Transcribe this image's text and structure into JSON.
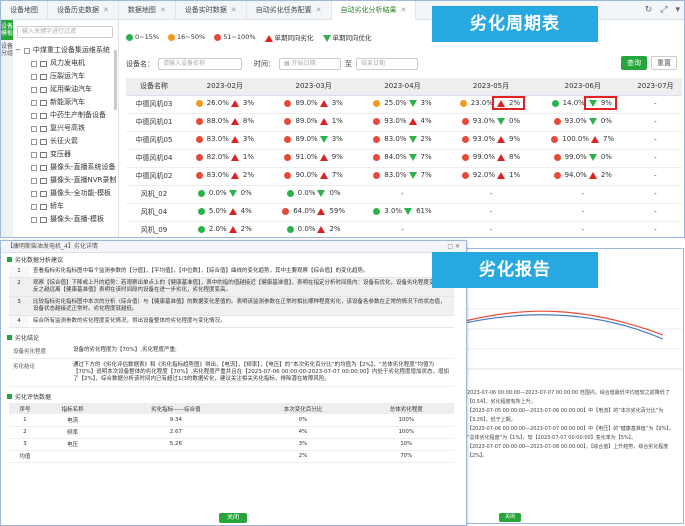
{
  "tabs": [
    {
      "label": "设备地图",
      "active": false
    },
    {
      "label": "设备历史数据",
      "active": false
    },
    {
      "label": "数据地图",
      "active": false
    },
    {
      "label": "设备实时数据",
      "active": false
    },
    {
      "label": "自动劣化任务配置",
      "active": false
    },
    {
      "label": "自动劣化分析结果",
      "active": true
    }
  ],
  "sidebar": {
    "vtabs": [
      "设备模板",
      "设备分组"
    ],
    "search_placeholder": "输入关键字进行过滤",
    "root": "中煤重工设备集运维系统",
    "items": [
      "风力发电机",
      "压裂运汽车",
      "延用柴油汽车",
      "新能源汽车",
      "中药生产制备设备",
      "复兴号高铁",
      "长征火箭",
      "变压器",
      "摄像头-直播系统设备",
      "摄像头-直播NVR录制",
      "摄像头-全功能-模板",
      "轿车",
      "摄像头-直播-模板"
    ]
  },
  "legend": {
    "items": [
      "0~15%",
      "16~50%",
      "51~100%",
      "单期同向劣化",
      "单期同向优化"
    ],
    "colors": [
      "#2bb24c",
      "#f39a1e",
      "#e74a3b"
    ]
  },
  "filter": {
    "device_label": "设备名：",
    "device_placeholder": "请输入设备名称",
    "time_label": "时间：",
    "start_placeholder": "开始日期",
    "sep": "至",
    "end_placeholder": "结束日期",
    "query": "查询",
    "reset": "重置"
  },
  "badges": {
    "top": "劣化周期表",
    "bottom": "劣化报告"
  },
  "table": {
    "headers": [
      "设备名称",
      "2023-02月",
      "2023-03月",
      "2023-04月",
      "2023-05月",
      "2023-06月",
      "2023-07月"
    ],
    "rows": [
      {
        "name": "中德风机03",
        "cells": [
          [
            "o",
            "26.0%",
            "up",
            "3%"
          ],
          [
            "r",
            "89.0%",
            "up",
            "3%"
          ],
          [
            "o",
            "25.0%",
            "dn",
            "3%"
          ],
          [
            "o",
            "23.0%",
            "up",
            "2%",
            true
          ],
          [
            "g",
            "14.0%",
            "dn",
            "9%",
            true
          ],
          [
            "",
            "-",
            "",
            ""
          ]
        ]
      },
      {
        "name": "中德风机01",
        "cells": [
          [
            "r",
            "88.0%",
            "up",
            "8%"
          ],
          [
            "r",
            "89.0%",
            "up",
            "1%"
          ],
          [
            "r",
            "93.0%",
            "up",
            "4%"
          ],
          [
            "r",
            "93.0%",
            "dn",
            "0%"
          ],
          [
            "r",
            "93.0%",
            "dn",
            "0%"
          ],
          [
            "",
            "-",
            "",
            ""
          ]
        ]
      },
      {
        "name": "中德风机05",
        "cells": [
          [
            "r",
            "83.0%",
            "up",
            "3%"
          ],
          [
            "r",
            "89.0%",
            "dn",
            "3%"
          ],
          [
            "r",
            "83.0%",
            "dn",
            "2%"
          ],
          [
            "r",
            "93.0%",
            "up",
            "9%"
          ],
          [
            "r",
            "100.0%",
            "up",
            "7%"
          ],
          [
            "",
            "-",
            "",
            ""
          ]
        ]
      },
      {
        "name": "中德风机04",
        "cells": [
          [
            "r",
            "82.0%",
            "up",
            "1%"
          ],
          [
            "r",
            "91.0%",
            "up",
            "9%"
          ],
          [
            "r",
            "84.0%",
            "dn",
            "7%"
          ],
          [
            "r",
            "99.0%",
            "up",
            "8%"
          ],
          [
            "r",
            "99.0%",
            "dn",
            "0%"
          ],
          [
            "",
            "-",
            "",
            ""
          ]
        ]
      },
      {
        "name": "中德风机02",
        "cells": [
          [
            "r",
            "83.0%",
            "up",
            "2%"
          ],
          [
            "r",
            "90.0%",
            "up",
            "7%"
          ],
          [
            "r",
            "83.0%",
            "dn",
            "7%"
          ],
          [
            "r",
            "92.0%",
            "up",
            "1%"
          ],
          [
            "r",
            "94.0%",
            "up",
            "2%"
          ],
          [
            "",
            "-",
            "",
            ""
          ]
        ]
      },
      {
        "name": "风机_02",
        "cells": [
          [
            "g",
            "0.0%",
            "dn",
            "0%"
          ],
          [
            "g",
            "0.0%",
            "dn",
            "0%"
          ],
          [
            "",
            "-",
            "",
            ""
          ],
          [
            "",
            "-",
            "",
            ""
          ],
          [
            "",
            "-",
            "",
            ""
          ],
          [
            "",
            "-",
            "",
            ""
          ]
        ]
      },
      {
        "name": "风机_04",
        "cells": [
          [
            "g",
            "5.0%",
            "up",
            "4%"
          ],
          [
            "r",
            "64.0%",
            "up",
            "59%"
          ],
          [
            "g",
            "3.0%",
            "dn",
            "61%"
          ],
          [
            "",
            "-",
            "",
            ""
          ],
          [
            "",
            "-",
            "",
            ""
          ],
          [
            "",
            "-",
            "",
            ""
          ]
        ]
      },
      {
        "name": "风机_09",
        "cells": [
          [
            "g",
            "2.0%",
            "up",
            "2%"
          ],
          [
            "g",
            "0.0%",
            "up",
            "2%"
          ],
          [
            "",
            "-",
            "",
            ""
          ],
          [
            "",
            "-",
            "",
            ""
          ],
          [
            "",
            "-",
            "",
            ""
          ],
          [
            "",
            "-",
            "",
            ""
          ]
        ]
      }
    ]
  },
  "report": {
    "header": "【康明斯柴油发电机_4】劣化详情",
    "sec1": "劣化数据分析建议",
    "suggestions": [
      {
        "n": "1",
        "text": "查看指标劣化指标图中每个监测参数的【分值】，【平均值】，【中位数】，【综合值】曲线的变化趋势，其中主要观察【综合值】的变化趋势。"
      },
      {
        "n": "2",
        "text": "观察【综合值】下降或上升的趋势：若观察出单点上的【健康基准值】，表中的指的值越接近【健康基准值】，表明在指定分析时间段内：设备有优化，设备劣化程度变低；反之越远离【健康基准值】表明在该时间段内设备在进一步劣化，劣化程度变高。"
      },
      {
        "n": "3",
        "text": "比较指标劣化指标图中本次的分析（综合值）与【健康基准值】的数据变化差值的。表明该监测参数在正常时相比哪种程度劣化，该设备各参数在正常的情况下的状态值，设备状态越接近正常时。劣化程度就越低。"
      },
      {
        "n": "4",
        "text": "综合所有监测参数的劣化程度变化情况，得出设备整体的劣化程度与变化情况。"
      }
    ],
    "sec2": "劣化结论",
    "conclusion_k1": "设备劣化程度",
    "conclusion_v1": "设备的劣化程度为【70%】,劣化程度严重;",
    "conclusion_k2": "劣化结论",
    "conclusion_v2": "通过下方的《劣化评估数据表》和《劣化指标趋势图》得出，【电流】，【频率】，【电压】的“本次劣化百分比”的均值为【2%】，“总体劣化程度”均值为【70%】说明本次设备整体的劣化程度【70%】,劣化程度严重并且在【2023-07-06 00:00:00-2023-07-07 00:00:00】内处于劣化程度增加状态，增加了【2%】，综合数据分析该时间内已有超过1/3的数据劣化，建议关注相关劣化指标，排除潜在故障风险。",
    "sec3": "劣化评估数据",
    "t2_headers": [
      "序号",
      "指标名称",
      "劣化指标——综合值",
      "本次变化百分比",
      "总体劣化程度"
    ],
    "t2_rows": [
      [
        "1",
        "电流",
        "9.34",
        "0%",
        "100%"
      ],
      [
        "2",
        "频率",
        "2.67",
        "4%",
        "100%"
      ],
      [
        "3",
        "电压",
        "5.26",
        "3%",
        "10%"
      ],
      [
        "均值",
        "",
        "",
        "2%",
        "70%"
      ]
    ],
    "close": "关闭"
  },
  "chart_panel": {
    "text": [
      "2023-07-06 00:00:00—2023-07-07 00:00:00 范围内，综合值最低平均值较之前降低了【0.54】，劣化程度有所上升。",
      "【2023-07-05 00:00:00—2023-07-06 00:00:00】中【电流】的“本次劣化百分比”为【3.26】，低于上期。",
      "【2023-07-06 00:00:00—2023-07-07 00:00:00】中【电压】的“健康基准值”为【9%】。",
      "“总体劣化程度”为【1%】，较【2023-07-07 00:00:00】变化率为【5%】。",
      "【2023-07-07 00:00:00—2023-07-08 00:00:00】，【综合值】上升趋势，综合劣化程度【2%】。"
    ],
    "close": "关闭"
  }
}
